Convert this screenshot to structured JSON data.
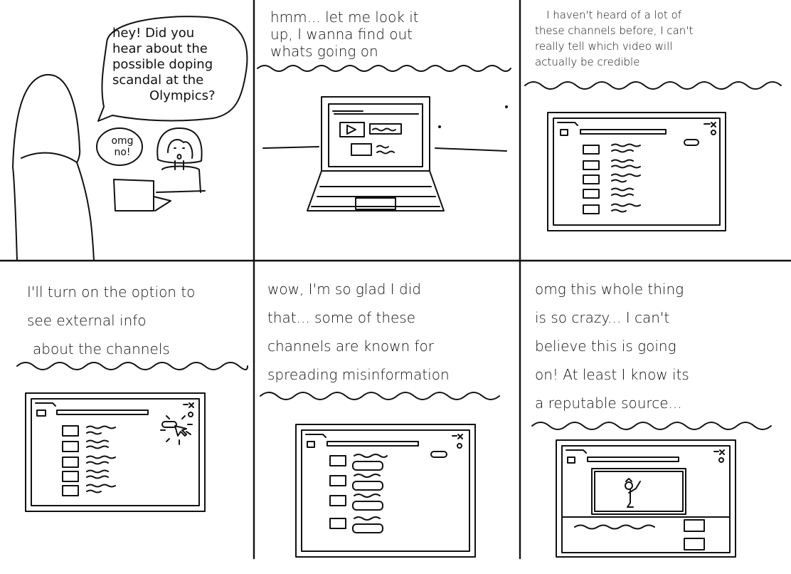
{
  "panel1": {
    "bubble_lines": [
      "hey! Did you",
      "hear about the",
      "possible doping",
      "scandal at the",
      "Olympics?"
    ],
    "reply_lines": [
      "omg",
      "no!"
    ]
  },
  "panel2": {
    "caption_lines": [
      "hmm... let me look it",
      "up, I wanna find out",
      "whats going on"
    ]
  },
  "panel3": {
    "caption_lines": [
      "I haven't heard of a lot of",
      "these channels before, I can't",
      "really tell which video will",
      "actually be credible"
    ]
  },
  "panel4": {
    "caption_lines": [
      "I'll turn on the option to",
      "see external info",
      "about the channels"
    ]
  },
  "panel5": {
    "caption_lines": [
      "wow, I'm so glad I did",
      "that... some of these",
      "channels are known for",
      "spreading misinformation"
    ]
  },
  "panel6": {
    "caption_lines": [
      "omg this whole thing",
      "is so crazy... I can't",
      "believe this is going",
      "on! At least I know its",
      "a reputable source..."
    ]
  },
  "colors": {
    "ink": "#111111",
    "paper": "#ffffff"
  }
}
